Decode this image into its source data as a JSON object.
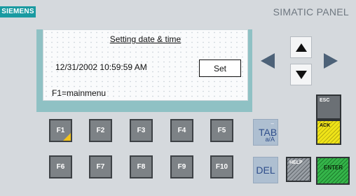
{
  "header": {
    "brand": "SIEMENS",
    "product": "SIMATIC PANEL"
  },
  "screen": {
    "title": "Setting date & time",
    "datetime": "12/31/2002 10:59:59 AM",
    "set_label": "Set",
    "hint": "F1=mainmenu"
  },
  "function_keys": {
    "row1": [
      "F1",
      "F2",
      "F3",
      "F4",
      "F5"
    ],
    "row2": [
      "F6",
      "F7",
      "F8",
      "F9",
      "F10"
    ]
  },
  "navigation": {
    "up_icon": "triangle-up-icon",
    "down_icon": "triangle-down-icon",
    "left_icon": "triangle-left-icon",
    "right_icon": "triangle-right-icon"
  },
  "control_keys": {
    "tab": "TAB",
    "tab_sub": "a/A",
    "tab_dash": "–",
    "del": "DEL",
    "esc": "ESC",
    "ack": "ACK",
    "help": "HELP",
    "enter": "ENTER"
  },
  "colors": {
    "brand": "#1a9aa1",
    "screen_frame": "#8fc1c4",
    "panel": "#d5d9dd",
    "nav_arrow": "#4d6278",
    "enter": "#35b54a",
    "ack": "#f0e418"
  }
}
